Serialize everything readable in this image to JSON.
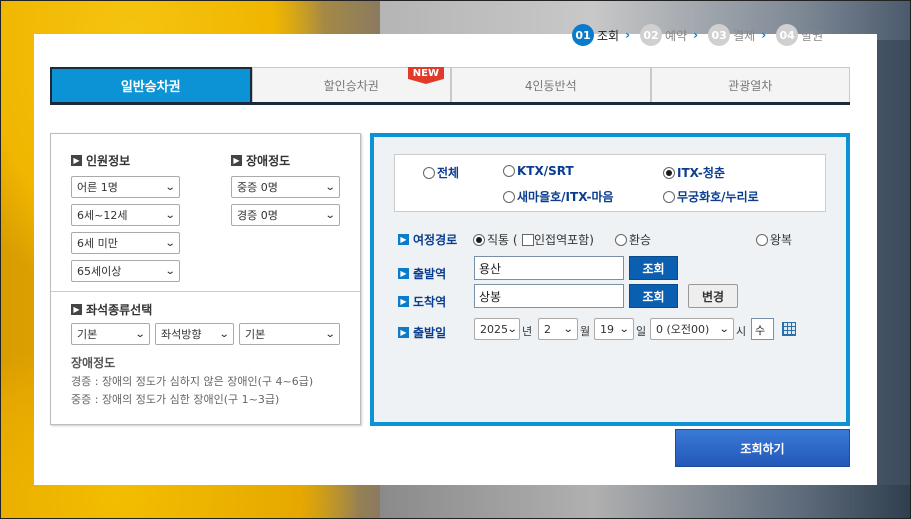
{
  "steps": [
    {
      "num": "01",
      "label": "조회",
      "active": true
    },
    {
      "num": "02",
      "label": "예약",
      "active": false
    },
    {
      "num": "03",
      "label": "결제",
      "active": false
    },
    {
      "num": "04",
      "label": "발권",
      "active": false
    }
  ],
  "tabs": {
    "general": "일반승차권",
    "discount": "할인승차권",
    "new_badge": "NEW",
    "group4": "4인동반석",
    "tour": "관광열차"
  },
  "passengers": {
    "title": "인원정보",
    "adult": "어른 1명",
    "child": "6세~12세",
    "infant": "6세 미만",
    "senior": "65세이상"
  },
  "disability": {
    "title": "장애정도",
    "severe": "중증 0명",
    "mild": "경증 0명"
  },
  "seat": {
    "title": "좌석종류선택",
    "type": "기본",
    "direction": "좌석방향",
    "position": "기본"
  },
  "notes": {
    "title": "장애정도",
    "mild": "경증 : 장애의 정도가 심하지 않은 장애인(구 4~6급)",
    "severe": "중증 : 장애의 정도가 심한 장애인(구 1~3급)"
  },
  "train_types": {
    "all": "전체",
    "ktx": "KTX/SRT",
    "itx_youth": "ITX-청춘",
    "saemaeul": "새마을호/ITX-마음",
    "mugunghwa": "무궁화호/누리로",
    "selected": "itx_youth"
  },
  "route": {
    "label": "여정경로",
    "direct": "직통 (",
    "include_adjacent": "인접역포함)",
    "transfer": "환승",
    "roundtrip": "왕복"
  },
  "departure": {
    "label": "출발역",
    "value": "용산",
    "search": "조회"
  },
  "arrival": {
    "label": "도착역",
    "value": "상봉",
    "search": "조회",
    "swap": "변경"
  },
  "date": {
    "label": "출발일",
    "year": "2025",
    "year_unit": "년",
    "month": "2",
    "month_unit": "월",
    "day": "19",
    "day_unit": "일",
    "hour": "0 (오전00)",
    "hour_unit": "시",
    "weekday": "수"
  },
  "search_button": "조회하기",
  "icons": {
    "calendar": "calendar-icon",
    "chevron": "chevron-down-icon",
    "section": "section-arrow-icon"
  },
  "colors": {
    "accent": "#0b93d6",
    "active_tab": "#0b93d6",
    "search_button": "#2a66c8",
    "label_text": "#0a3d8f",
    "new_badge": "#e03a2a"
  }
}
